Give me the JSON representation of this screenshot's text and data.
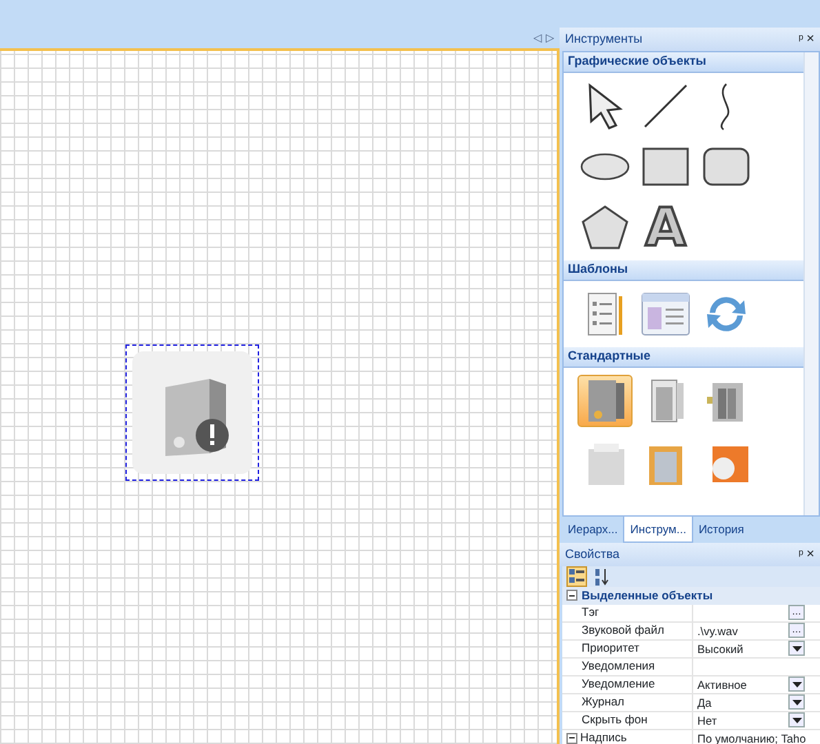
{
  "canvas": {
    "nav_arrows": [
      "◁",
      "▷"
    ],
    "objects": [
      {
        "kind": "picture",
        "selected": true
      }
    ]
  },
  "tools_panel": {
    "title": "Инструменты",
    "pin": "ᵖ",
    "close": "×",
    "sections": [
      {
        "title": "Графические объекты",
        "items": [
          {
            "kind": "arrow"
          },
          {
            "kind": "line"
          },
          {
            "kind": "curve"
          },
          {
            "kind": "ellipse"
          },
          {
            "kind": "rect"
          },
          {
            "kind": "roundrect"
          },
          {
            "kind": "pentagon"
          },
          {
            "kind": "letter",
            "text": "A"
          }
        ]
      },
      {
        "title": "Шаблоны",
        "items": [
          {
            "kind": "form"
          },
          {
            "kind": "window"
          },
          {
            "kind": "refresh"
          }
        ]
      },
      {
        "title": "Стандартные",
        "items": [
          {
            "kind": "panel",
            "selected": true
          },
          {
            "kind": "door",
            "selected": false
          },
          {
            "kind": "elevator",
            "selected": false
          },
          {
            "kind": "building",
            "selected": false
          },
          {
            "kind": "frame",
            "selected": false
          },
          {
            "kind": "badge",
            "selected": false
          }
        ]
      }
    ],
    "tabs": [
      {
        "label": "Иерарх...",
        "selected": false
      },
      {
        "label": "Инструм...",
        "selected": true
      },
      {
        "label": "История",
        "selected": false
      }
    ]
  },
  "properties_panel": {
    "title": "Свойства",
    "pin": "ᵖ",
    "close": "×",
    "toolbar": [
      {
        "kind": "categorized",
        "selected": true
      },
      {
        "kind": "alphabetical",
        "selected": false
      }
    ],
    "category": {
      "title": "Выделенные объекты",
      "expanded": true
    },
    "rows": [
      {
        "kind": "ellipsis",
        "name": "Тэг",
        "button": "…"
      },
      {
        "kind": "ellipsis",
        "name": "Звуковой файл",
        "value": ".\\vy.wav",
        "button": "…"
      },
      {
        "kind": "dropdown",
        "name": "Приоритет",
        "value": "Высокий"
      },
      {
        "kind": "plain",
        "name": "Уведомления"
      },
      {
        "kind": "dropdown",
        "name": "Уведомление",
        "value": "Активное"
      },
      {
        "kind": "dropdown",
        "name": "Журнал",
        "value": "Да"
      },
      {
        "kind": "dropdown",
        "name": "Скрыть фон",
        "value": "Нет"
      },
      {
        "kind": "group",
        "name": "Надпись",
        "value": "По умолчанию; Taho",
        "expanded": true
      }
    ]
  }
}
